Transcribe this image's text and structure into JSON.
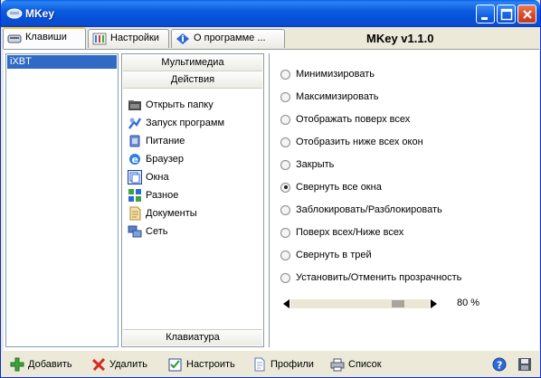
{
  "window": {
    "title": "MKey"
  },
  "tabs": [
    {
      "label": "Клавиши",
      "icon": "keyboard-icon",
      "active": true
    },
    {
      "label": "Настройки",
      "icon": "settings-icon",
      "active": false
    },
    {
      "label": "О программе ...",
      "icon": "info-icon",
      "active": false
    }
  ],
  "version": "MKey v1.1.0",
  "profiles": [
    {
      "label": "iXBT",
      "selected": true
    }
  ],
  "categories": {
    "headers": {
      "top1": "Мультимедиа",
      "top2": "Действия",
      "bottom": "Клавиатура"
    },
    "items": [
      {
        "label": "Открыть папку",
        "icon": "folder-icon"
      },
      {
        "label": "Запуск программ",
        "icon": "run-programs-icon"
      },
      {
        "label": "Питание",
        "icon": "power-icon"
      },
      {
        "label": "Браузер",
        "icon": "browser-icon"
      },
      {
        "label": "Окна",
        "icon": "windows-icon"
      },
      {
        "label": "Разное",
        "icon": "misc-icon"
      },
      {
        "label": "Документы",
        "icon": "documents-icon"
      },
      {
        "label": "Сеть",
        "icon": "network-icon"
      }
    ]
  },
  "actions": [
    {
      "label": "Минимизировать",
      "checked": false
    },
    {
      "label": "Максимизировать",
      "checked": false
    },
    {
      "label": "Отображать поверх всех",
      "checked": false
    },
    {
      "label": "Отобразить ниже всех окон",
      "checked": false
    },
    {
      "label": "Закрыть",
      "checked": false
    },
    {
      "label": "Свернуть все окна",
      "checked": true
    },
    {
      "label": "Заблокировать/Разблокировать",
      "checked": false
    },
    {
      "label": "Поверх всех/Ниже всех",
      "checked": false
    },
    {
      "label": "Свернуть в трей",
      "checked": false
    },
    {
      "label": "Установить/Отменить прозрачность",
      "checked": false
    }
  ],
  "transparency": {
    "value": 80,
    "label": "80 %"
  },
  "toolbar": {
    "add": "Добавить",
    "delete": "Удалить",
    "configure": "Настроить",
    "profiles": "Профили",
    "list": "Список"
  },
  "colors": {
    "title_bar": "#0a5fe6",
    "selection": "#316ac5",
    "close_button": "#d8462a"
  }
}
